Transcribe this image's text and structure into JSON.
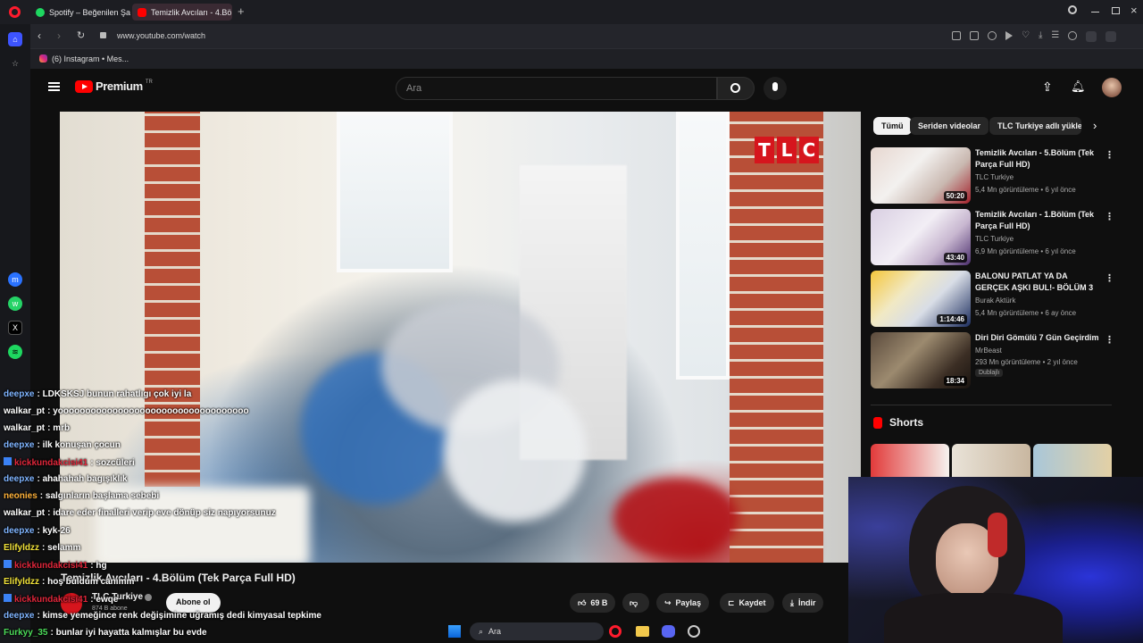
{
  "browser": {
    "tabs": [
      {
        "label": "Spotify – Beğenilen Şarkılar",
        "active": false
      },
      {
        "label": "Temizlik Avcıları - 4.Bölüm",
        "active": true
      }
    ],
    "url": "www.youtube.com/watch",
    "bookmark": "(6) Instagram • Mes..."
  },
  "youtube": {
    "logo": "Premium",
    "logo_sup": "TR",
    "search_placeholder": "Ara",
    "chips": [
      "Tümü",
      "Seriden videolar",
      "TLC Turkiye adlı yükle"
    ],
    "video": {
      "title": "Temizlik Avcıları - 4.Bölüm (Tek Parça Full HD)",
      "channel": "TLC Turkiye",
      "subscribers": "874 B abone",
      "subscribe": "Abone ol",
      "likes": "69 B",
      "share": "Paylaş",
      "save": "Kaydet",
      "download": "İndir",
      "watermark": [
        "T",
        "L",
        "C"
      ]
    },
    "recommendations": [
      {
        "title": "Temizlik Avcıları - 5.Bölüm (Tek Parça Full HD)",
        "channel": "TLC Turkiye",
        "views": "5,4 Mn görüntüleme",
        "age": "6 yıl önce",
        "duration": "50:20"
      },
      {
        "title": "Temizlik Avcıları - 1.Bölüm (Tek Parça Full HD)",
        "channel": "TLC Turkiye",
        "views": "6,9 Mn görüntüleme",
        "age": "6 yıl önce",
        "duration": "43:40"
      },
      {
        "title": "BALONU PATLAT YA DA GERÇEK AŞKI BUL!- BÖLÜM 3",
        "channel": "Burak Aktürk",
        "views": "5,4 Mn görüntüleme",
        "age": "6 ay önce",
        "duration": "1:14:46"
      },
      {
        "title": "Diri Diri Gömülü 7 Gün Geçirdim",
        "channel": "MrBeast",
        "views": "293 Mn görüntüleme",
        "age": "2 yıl önce",
        "duration": "18:34",
        "badge": "Dublajlı"
      }
    ],
    "shorts_label": "Shorts"
  },
  "chat": [
    {
      "user": "deepxe",
      "color": "#7fb4ff",
      "msg": ": LDKSKSJ bunun rahatlıgı çok iyi la"
    },
    {
      "user": "walkar_pt",
      "color": "#ffffff",
      "msg": ": yooooooooooooooooooooooooooooooooooo"
    },
    {
      "user": "walkar_pt",
      "color": "#ffffff",
      "msg": ": mrb"
    },
    {
      "user": "deepxe",
      "color": "#7fb4ff",
      "msg": ": ilk konuşan çocun"
    },
    {
      "user": "kickkundakcisi41",
      "color": "#e0263a",
      "msg": ": sozcüleri"
    },
    {
      "user": "deepxe",
      "color": "#7fb4ff",
      "msg": ": ahahahah bagışıklık"
    },
    {
      "user": "neonies",
      "color": "#ffb23a",
      "msg": ": salgınların başlama sebebi"
    },
    {
      "user": "walkar_pt",
      "color": "#ffffff",
      "msg": ": idare eder finalleri verip eve dönüp siz napıyorsunuz"
    },
    {
      "user": "deepxe",
      "color": "#7fb4ff",
      "msg": ": kyk-26"
    },
    {
      "user": "Elifyldzz",
      "color": "#f2e33a",
      "msg": ": selamm"
    },
    {
      "user": "kickkundakcisi41",
      "color": "#e0263a",
      "msg": ": hg"
    },
    {
      "user": "Elifyldzz",
      "color": "#f2e33a",
      "msg": ": hoş buldum canımm"
    },
    {
      "user": "kickkundakcisi41",
      "color": "#e0263a",
      "msg": ": ewqe"
    },
    {
      "user": "deepxe",
      "color": "#7fb4ff",
      "msg": ": kimse yemeğince renk değişimine uğramış dedi kimyasal tepkime"
    },
    {
      "user": "Furkyy_35",
      "color": "#4ddc5a",
      "msg": ": bunlar iyi hayatta kalmışlar bu evde"
    }
  ],
  "taskbar": {
    "search": "Ara"
  },
  "colors": {
    "accent": "#ff0000",
    "tlc": "#d6151d"
  }
}
